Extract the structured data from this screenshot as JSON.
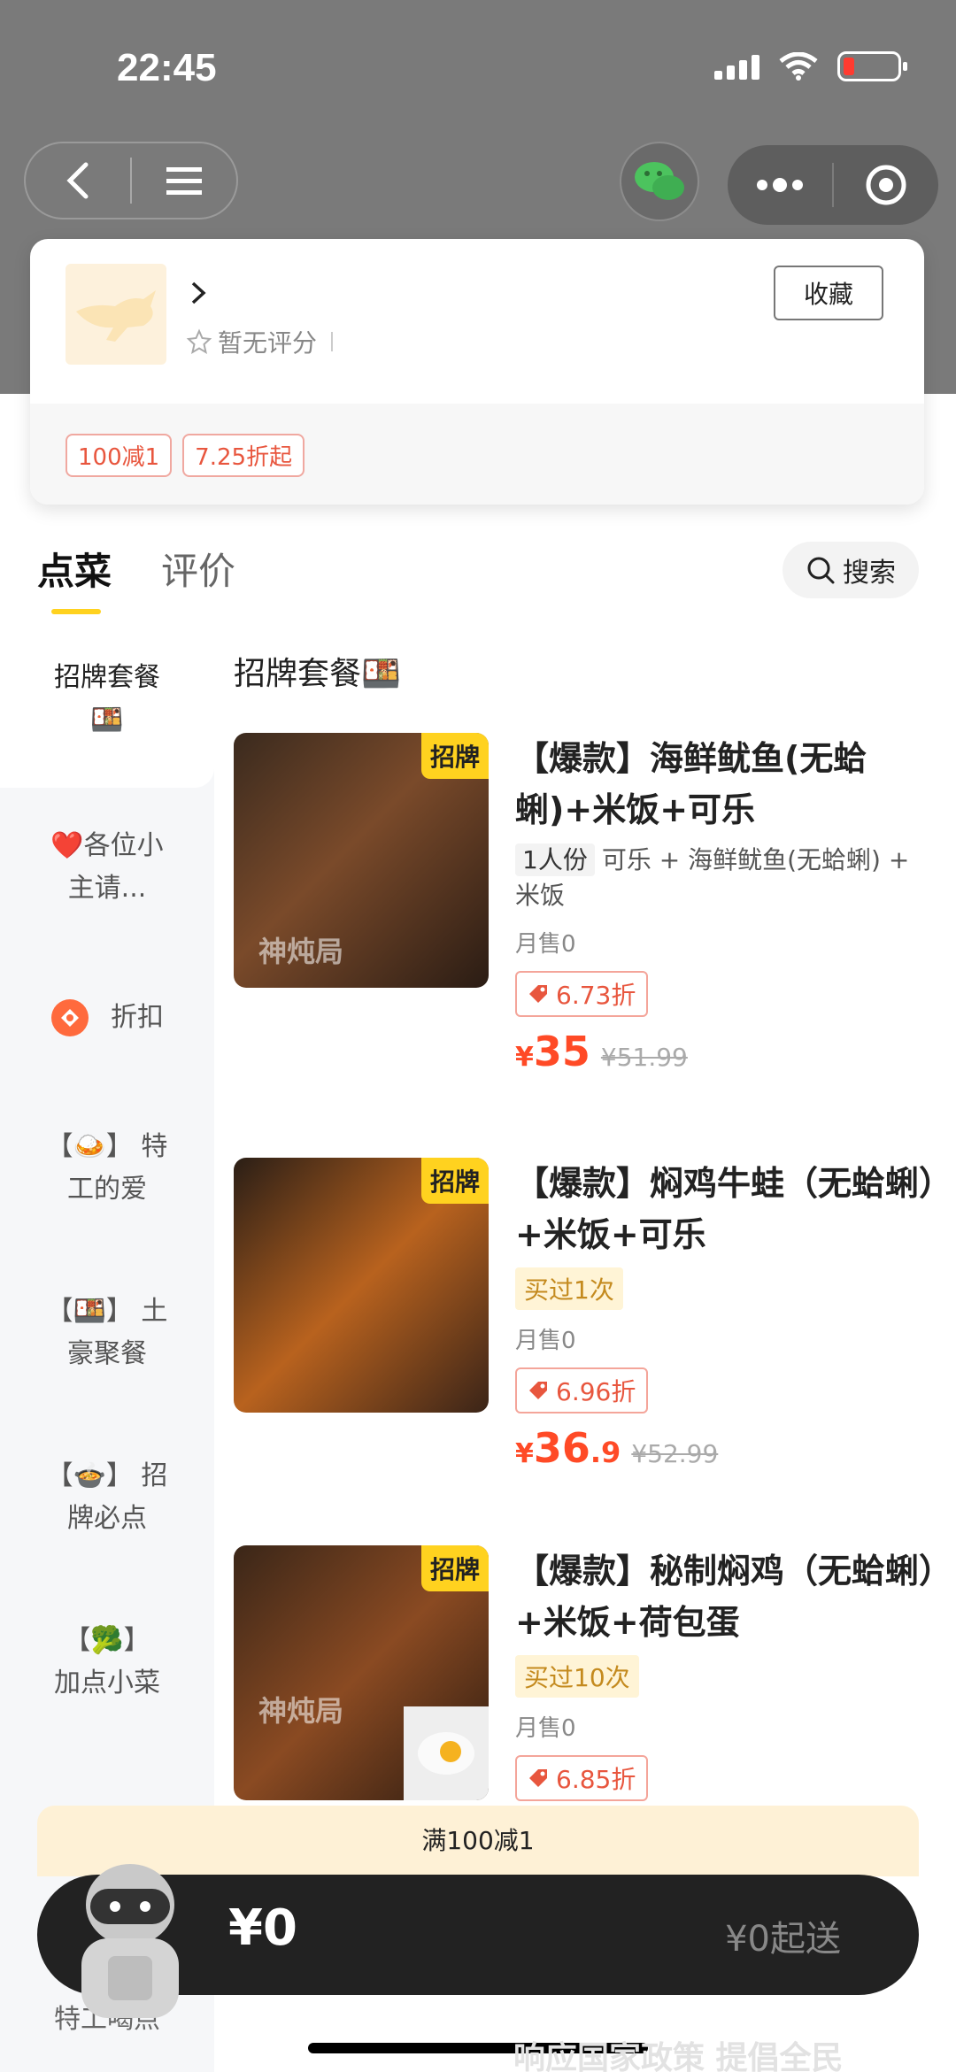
{
  "status_bar": {
    "time": "22:45"
  },
  "store": {
    "rating_text": "暂无评分",
    "favorite_label": "收藏",
    "promo_tags": [
      "100减1",
      "7.25折起"
    ]
  },
  "tabs": [
    {
      "label": "点菜",
      "active": true
    },
    {
      "label": "评价",
      "active": false
    }
  ],
  "search": {
    "label": "搜索"
  },
  "sidebar": {
    "items": [
      {
        "line1": "招牌套餐",
        "line2": "🍱"
      },
      {
        "line1": "❤️各位小",
        "line2": "主请..."
      },
      {
        "line1": "折扣",
        "line2": ""
      },
      {
        "line1": "【🍛】 特",
        "line2": "工的爱"
      },
      {
        "line1": "【🍱】 土",
        "line2": "豪聚餐"
      },
      {
        "line1": "【🍲】 招",
        "line2": "牌必点"
      },
      {
        "line1": "【🥦】",
        "line2": "加点小菜"
      },
      {
        "line1": "特工喝点",
        "line2": ""
      }
    ]
  },
  "section": {
    "title": "招牌套餐🍱"
  },
  "products": [
    {
      "tag": "招牌",
      "watermark": "神炖局",
      "name": "【爆款】海鲜鱿鱼(无蛤蜊)+米饭+可乐",
      "portion": "1人份",
      "desc": "可乐 + 海鲜鱿鱼(无蛤蜊) + 米饭",
      "bought": "",
      "sold": "月售0",
      "discount": "6.73折",
      "price_yen": "¥",
      "price_int": "35",
      "price_dec": "",
      "orig_price": "¥51.99"
    },
    {
      "tag": "招牌",
      "watermark": "",
      "name": "【爆款】焖鸡牛蛙（无蛤蜊）+米饭+可乐",
      "portion": "",
      "desc": "",
      "bought": "买过1次",
      "sold": "月售0",
      "discount": "6.96折",
      "price_yen": "¥",
      "price_int": "36",
      "price_dec": ".9",
      "orig_price": "¥52.99"
    },
    {
      "tag": "招牌",
      "watermark": "神炖局",
      "name": "【爆款】秘制焖鸡（无蛤蜊）+米饭+荷包蛋",
      "portion": "",
      "desc": "",
      "bought": "买过10次",
      "sold": "月售0",
      "discount": "6.85折",
      "price_yen": "",
      "price_int": "",
      "price_dec": "",
      "orig_price": ""
    }
  ],
  "cart": {
    "promo_text": "满100减1",
    "total": "¥0",
    "min_order": "¥0起送"
  },
  "bottom_peek_text": "响应国家政策 提倡全民",
  "colors": {
    "accent_yellow": "#ffd21f",
    "price_red": "#ff4a26",
    "cart_bg": "#222222"
  }
}
